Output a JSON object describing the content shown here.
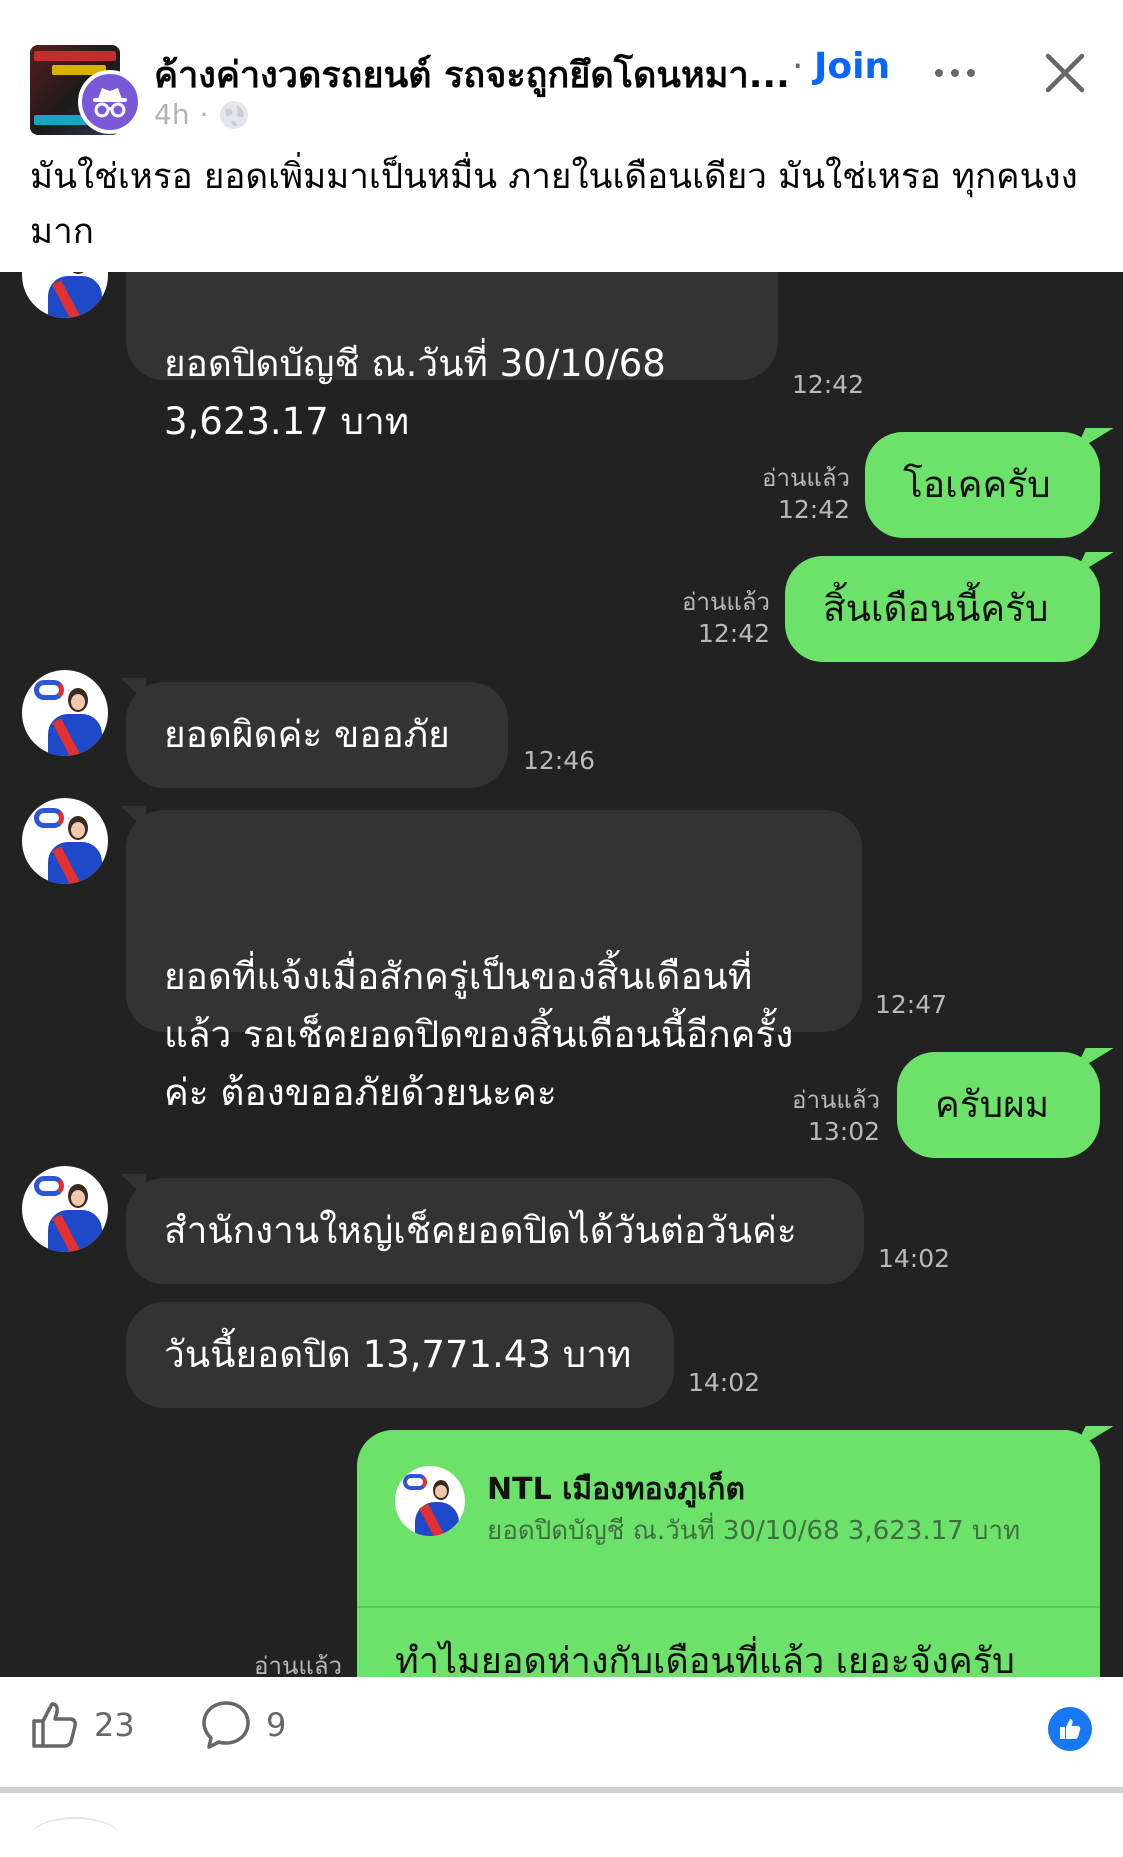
{
  "post": {
    "group_name": "ค้างค่างวดรถยนต์ รถจะถูกยึดโดนหมา...",
    "separator": "·",
    "join_label": "Join",
    "time_ago": "4h",
    "meta_separator": "·",
    "text": "มันใช่เหรอ ยอดเพิ่มมาเป็นหมื่น ภายในเดือนเดียว มันใช่เหรอ ทุกคนงงมาก",
    "icons": {
      "more": "more-horizontal-icon",
      "close": "close-icon",
      "privacy": "globe-icon",
      "anon": "anonymous-incognito-icon"
    }
  },
  "chat": {
    "messages": [
      {
        "side": "left",
        "text": "ยอดปิดบัญชี ณ.วันที่  30/10/68\n3,623.17  บาท",
        "time": "12:42"
      },
      {
        "side": "right",
        "text": "โอเคครับ",
        "read": "อ่านแล้ว",
        "time": "12:42"
      },
      {
        "side": "right",
        "text": "สิ้นเดือนนี้ครับ",
        "read": "อ่านแล้ว",
        "time": "12:42"
      },
      {
        "side": "left",
        "text": "ยอดผิดค่ะ ขออภัย",
        "time": "12:46"
      },
      {
        "side": "left",
        "text": "ยอดที่แจ้งเมื่อสักครู่เป็นของสิ้นเดือนที่\nแล้ว รอเช็คยอดปิดของสิ้นเดือนนี้อีกครั้ง\nค่ะ ต้องขออภัยด้วยนะคะ",
        "time": "12:47"
      },
      {
        "side": "right",
        "text": "ครับผม",
        "read": "อ่านแล้ว",
        "time": "13:02"
      },
      {
        "side": "left",
        "text": "สำนักงานใหญ่เช็คยอดปิดได้วันต่อวันค่ะ",
        "time": "14:02"
      },
      {
        "side": "left",
        "text": "วันนี้ยอดปิด 13,771.43 บาท",
        "time": "14:02"
      }
    ],
    "reply": {
      "quoted_name": "NTL เมืองทองภูเก็ต",
      "quoted_text": "ยอดปิดบัญชี ณ.วันที่ 30/10/68 3,623.17 บาท",
      "message": "ทำไมยอดห่างกับเดือนที่แล้ว เยอะจังครับ",
      "read": "อ่านแล้ว"
    }
  },
  "footer": {
    "like_count": "23",
    "comment_count": "9",
    "icons": {
      "like": "thumbs-up-icon",
      "comment": "comment-bubble-icon",
      "reaction": "like-reaction-icon"
    }
  },
  "colors": {
    "join": "#0866ff",
    "chat_bg": "#222222",
    "left_bubble": "#333333",
    "right_bubble": "#6ce26b",
    "reaction": "#1877f2"
  }
}
